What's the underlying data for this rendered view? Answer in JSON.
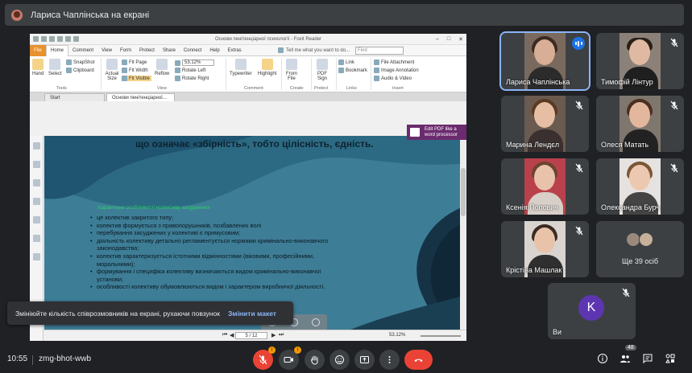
{
  "presenter_bar": {
    "title": "Лариса Чаплінська на екрані"
  },
  "reader": {
    "window_title": "Основи пенітенціарної психології - Foxit Reader",
    "menus": [
      "File",
      "Home",
      "Comment",
      "View",
      "Form",
      "Protect",
      "Share",
      "Connect",
      "Help",
      "Extras"
    ],
    "tell_me": "Tell me what you want to do...",
    "find_placeholder": "Find",
    "ribbon": {
      "hand": "Hand",
      "select": "Select",
      "snapshot": "SnapShot",
      "clipboard": "Clipboard",
      "actual_size": "Actual Size",
      "fit_page": "Fit Page",
      "fit_width": "Fit Width",
      "fit_visible": "Fit Visible",
      "reflow": "Reflow",
      "zoom": "53.12%",
      "rotate_left": "Rotate Left",
      "rotate_right": "Rotate Right",
      "typewriter": "Typewriter",
      "highlight": "Highlight",
      "from_file": "From File",
      "pdf_sign": "PDF Sign",
      "link": "Link",
      "bookmark": "Bookmark",
      "file_attachment": "File Attachment",
      "image_annotation": "Image Annotation",
      "audio_video": "Audio & Video",
      "groups": {
        "tools": "Tools",
        "view": "View",
        "comment": "Comment",
        "create": "Create",
        "protect": "Protect",
        "links": "Links",
        "insert": "Insert"
      }
    },
    "tabs": [
      "Start",
      "Основи пенітенціарної..."
    ],
    "edit_pdf": "Edit PDF like a word processor",
    "page": {
      "heading": "що означає «збірність», тобто цілісність, єдність.",
      "green_line": "Характерні особливості колективу засуджених",
      "bullets": [
        "це колектив закритого типу;",
        "колектив формується з правопорушників, позбавлених волі",
        " перебування засуджених у колективі є примусовим;",
        "діяльність колективу детально регламентується нормами кримінально-виконавчого законодавства;",
        "колектив характеризується істотними відмінностями (віковими, професійними, моральними);",
        "формування і специфіка колективу визначаються видом кримінально-виконавчої установи;",
        "особливості колективу обумовлюються видом і характером виробничої діяльності."
      ]
    },
    "status": {
      "page": "5 / 12",
      "zoom": "53.12%"
    }
  },
  "participants": [
    {
      "name": "Лариса Чаплінська",
      "speaking": true
    },
    {
      "name": "Тимофій Лінтур",
      "muted": true
    },
    {
      "name": "Марина Лендєл",
      "muted": true
    },
    {
      "name": "Олеся Матать",
      "muted": true
    },
    {
      "name": "Ксенія Попович",
      "muted": true
    },
    {
      "name": "Олександра Бурч",
      "muted": true
    },
    {
      "name": "Крістіна Машлак",
      "muted": true
    }
  ],
  "others": {
    "label": "Ще 39 осіб"
  },
  "self": {
    "name": "Ви",
    "initial": "K"
  },
  "toast": {
    "message": "Змініюйте кількість співрозмовників на екрані, рухаючи повзунок",
    "action": "Змінити макет"
  },
  "bottom": {
    "time": "10:55",
    "meeting_code": "zmg-bhot-wwb",
    "mic_badge": "!",
    "cam_badge": "!",
    "people_count": "48"
  },
  "colors": {
    "background": "#202124",
    "tile": "#3c4043",
    "accent": "#8ab4f8",
    "end_call": "#ea4335",
    "slide": "#3e7d96"
  }
}
